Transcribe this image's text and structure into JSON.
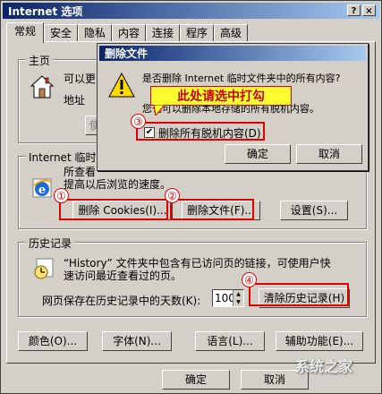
{
  "window": {
    "title": "Internet 选项",
    "help_glyph": "?",
    "close_glyph": "×"
  },
  "tabs": [
    "常规",
    "安全",
    "隐私",
    "内容",
    "连接",
    "程序",
    "高级"
  ],
  "home": {
    "group_title": "主页",
    "line1": "可以更",
    "address_label": "地址",
    "use_btn_partial": "使"
  },
  "temp": {
    "group_title": "Internet 临时",
    "line1": "所查看",
    "line2": "提高以后浏览的速度。",
    "delete_cookies": "删除 Cookies(I)...",
    "delete_files": "删除文件(F)...",
    "settings": "设置(S)..."
  },
  "history": {
    "group_title": "历史记录",
    "desc1": "“History” 文件夹中包含有已访问页的链接，可使用户快",
    "desc2": "速访问最近查看过的页。",
    "days_label": "网页保存在历史记录中的天数(K):",
    "days_value": "100",
    "clear_btn": "清除历史记录(H)"
  },
  "bottom_buttons": [
    "颜色(O)...",
    "字体(N)...",
    "语言(L)...",
    "辅助功能(E)..."
  ],
  "footer_buttons": [
    "确定",
    "取消"
  ],
  "dialog": {
    "title": "删除文件",
    "q1": "是否删除 Internet 临时文件夹中的所有内容?",
    "q2": "您也可以删除本地存储的所有脱机内容。",
    "checkbox_label": "删除所有脱机内容(D)",
    "checked": true,
    "ok": "确定",
    "cancel": "取消"
  },
  "annotation": {
    "callout": "此处请选中打勾",
    "n1": "①",
    "n2": "②",
    "n3": "③",
    "n4": "④",
    "color": "#e00000"
  },
  "watermark": "系统之家"
}
